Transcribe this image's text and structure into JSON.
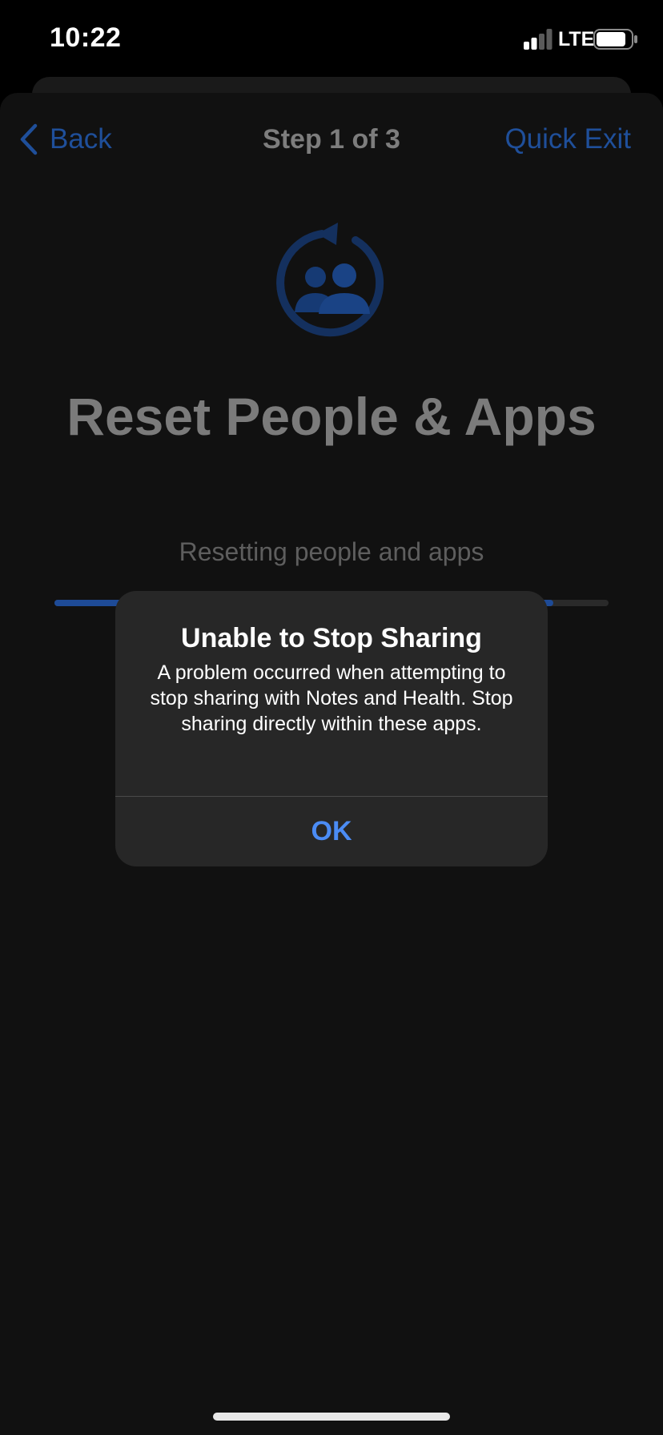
{
  "status_bar": {
    "time": "10:22",
    "network": "LTE",
    "icons": [
      "cellular-signal-icon",
      "battery-icon"
    ]
  },
  "nav": {
    "back_label": "Back",
    "title": "Step 1 of 3",
    "quick_exit_label": "Quick Exit",
    "back_icon": "chevron-left-icon"
  },
  "hero": {
    "icon": "people-reset-icon",
    "title": "Reset People & Apps"
  },
  "progress": {
    "label": "Resetting people and apps",
    "fraction": 0.9
  },
  "alert": {
    "title": "Unable to Stop Sharing",
    "message": "A problem occurred when attempting to stop sharing with Notes and Health. Stop sharing directly within these apps.",
    "ok_label": "OK"
  },
  "colors": {
    "accent": "#4b8cf5",
    "dimmed_accent": "#1f4f9a",
    "alert_background": "#272727",
    "sheet_background": "#111111"
  }
}
